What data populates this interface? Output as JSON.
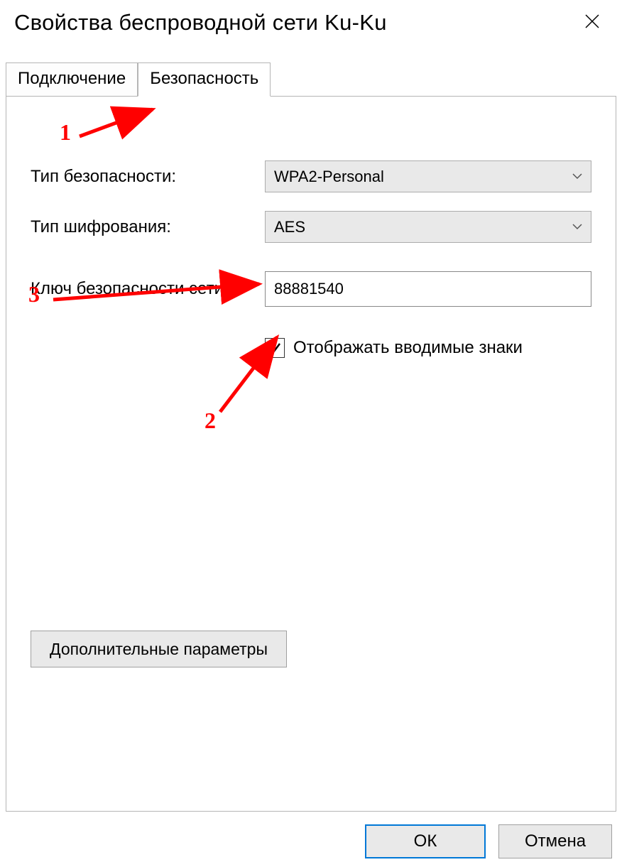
{
  "window": {
    "title": "Свойства беспроводной сети Ku-Ku"
  },
  "tabs": {
    "connection": "Подключение",
    "security": "Безопасность",
    "active": "security"
  },
  "form": {
    "security_type_label": "Тип безопасности:",
    "security_type_value": "WPA2-Personal",
    "encryption_type_label": "Тип шифрования:",
    "encryption_type_value": "AES",
    "network_key_label": "Ключ безопасности сети",
    "network_key_value": "88881540",
    "show_chars_label": "Отображать вводимые знаки",
    "show_chars_checked": true,
    "advanced_button": "Дополнительные параметры"
  },
  "footer": {
    "ok": "ОК",
    "cancel": "Отмена"
  },
  "annotations": {
    "n1": "1",
    "n2": "2",
    "n3": "3"
  }
}
